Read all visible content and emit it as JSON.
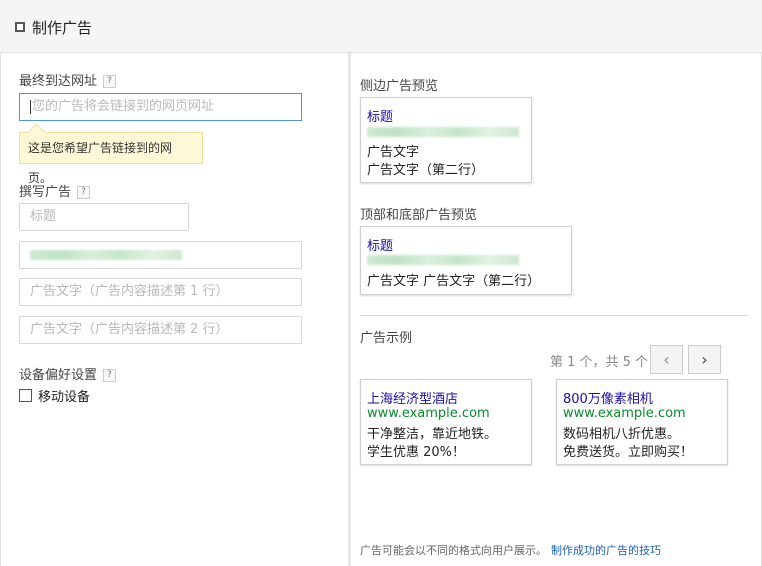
{
  "header": {
    "title": "制作广告"
  },
  "left": {
    "final_url": {
      "label": "最终到达网址",
      "help": "?",
      "placeholder": "您的广告将会链接到的网页网址"
    },
    "tooltip": "这是您希望广告链接到的网页。",
    "write_ad": {
      "label": "撰写广告",
      "help": "?",
      "headline_placeholder": "标题",
      "line1_placeholder": "广告文字（广告内容描述第 1 行）",
      "line2_placeholder": "广告文字（广告内容描述第 2 行）"
    },
    "device": {
      "label": "设备偏好设置",
      "help": "?",
      "mobile_label": "移动设备"
    }
  },
  "right": {
    "side_preview": {
      "label": "侧边广告预览",
      "title": "标题",
      "line1": "广告文字",
      "line2": "广告文字（第二行）"
    },
    "top_preview": {
      "label": "顶部和底部广告预览",
      "title": "标题",
      "line1": "广告文字 广告文字（第二行）"
    },
    "examples": {
      "label": "广告示例",
      "pager": "第 1 个，共 5 个",
      "prev": "‹",
      "next": "›",
      "items": [
        {
          "title": "上海经济型酒店",
          "url": "www.example.com",
          "line1": "干净整洁，靠近地铁。",
          "line2": "学生优惠 20%！"
        },
        {
          "title": "800万像素相机",
          "url": "www.example.com",
          "line1": "数码相机八折优惠。",
          "line2": "免费送货。立即购买！"
        }
      ]
    },
    "footer": {
      "text": "广告可能会以不同的格式向用户展示。",
      "link": "制作成功的广告的技巧"
    }
  }
}
